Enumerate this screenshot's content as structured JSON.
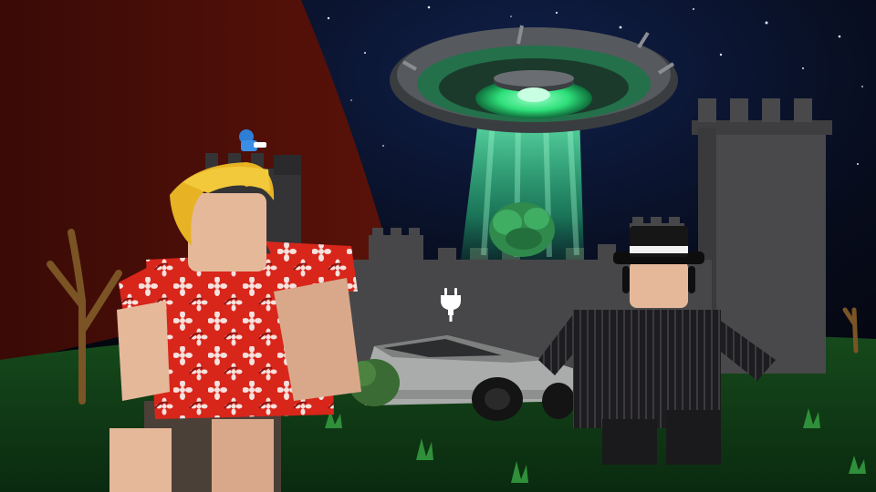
{
  "scene": {
    "icons": {
      "charging": "electric-plug-icon"
    },
    "colors": {
      "sky": "#05070f",
      "ground": "#0f3a16",
      "beam": "#39e08f",
      "ufo_glow": "#2ee07a",
      "mountain": "#4a0d07",
      "castle": "#4a4a4c",
      "hawaiian_shirt": "#d9261c",
      "hair": "#e8b423",
      "suit": "#1c1b1d"
    }
  }
}
